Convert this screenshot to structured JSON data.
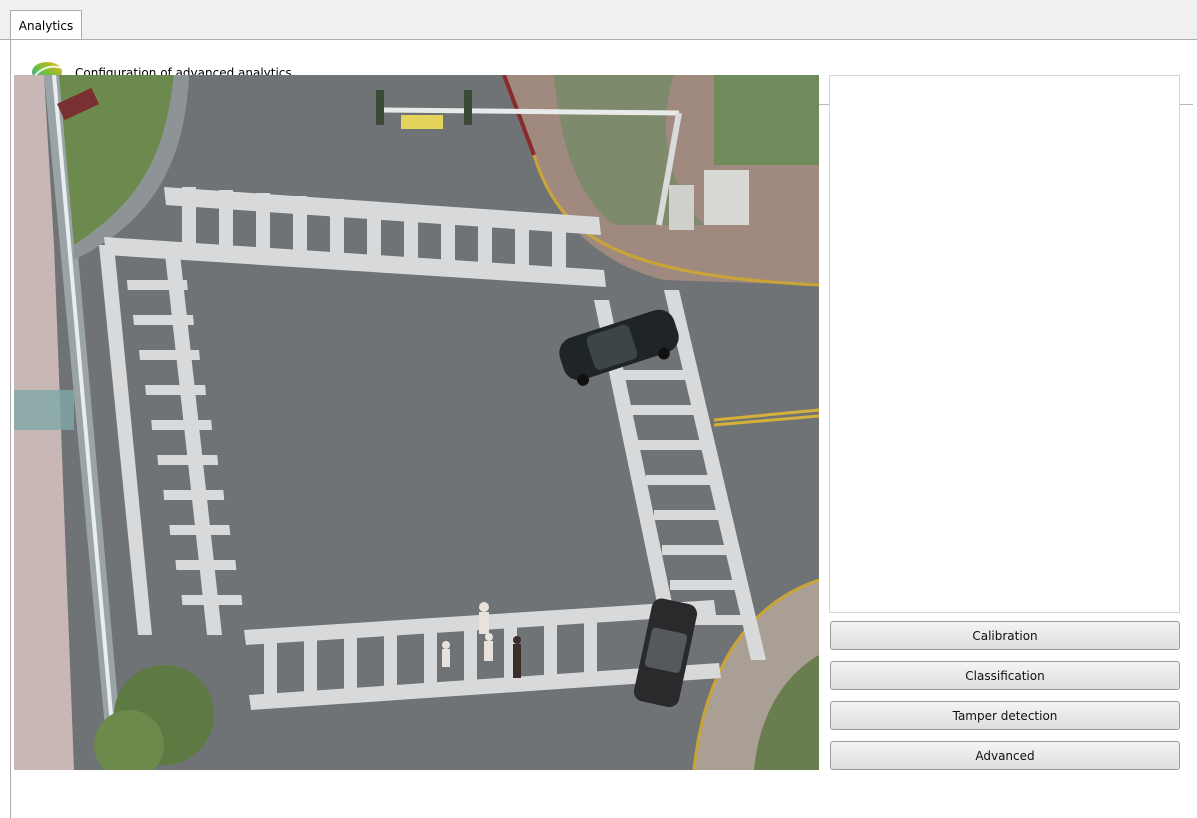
{
  "tabs": [
    {
      "label": "Analytics",
      "active": true
    }
  ],
  "header": {
    "icon": "analytics-logo-icon",
    "title": "Configuration of advanced analytics"
  },
  "video": {
    "content": "overhead-intersection-camera-feed"
  },
  "actions": {
    "calibration": "Calibration",
    "classification": "Classification",
    "tamper_detection": "Tamper detection",
    "advanced": "Advanced"
  },
  "colors": {
    "tab_bg": "#f0f0f0",
    "border": "#adadad",
    "button_top": "#f4f4f4",
    "button_bottom": "#dedede"
  }
}
